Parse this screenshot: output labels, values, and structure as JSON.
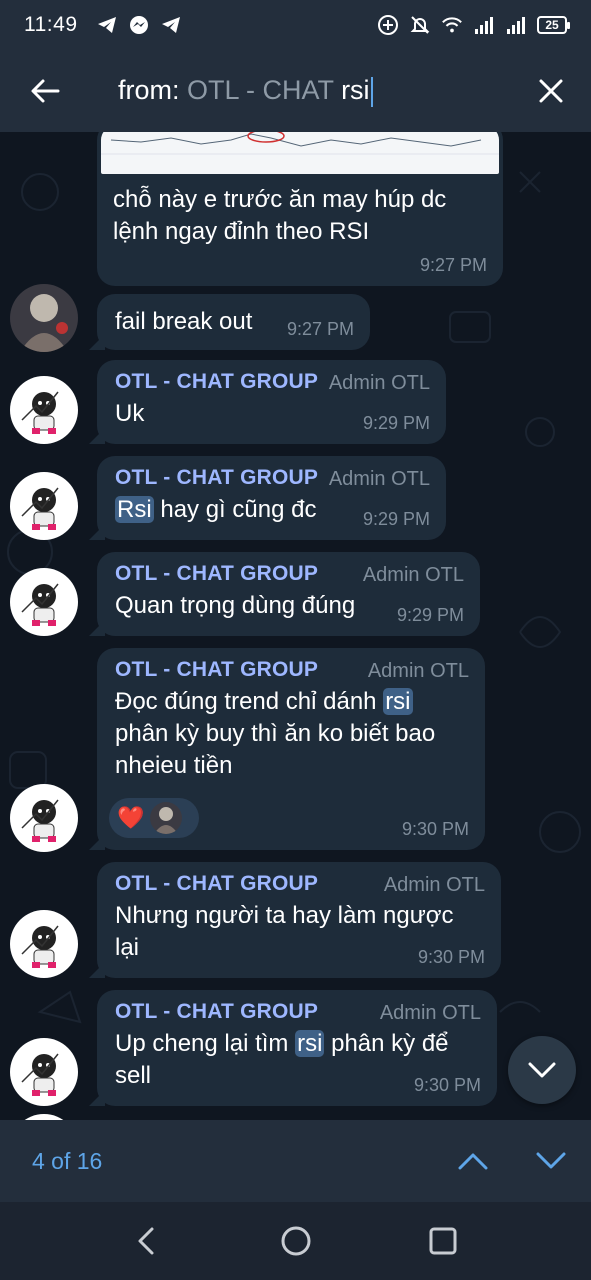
{
  "status_bar": {
    "time": "11:49",
    "battery": "25",
    "icons_left": [
      "telegram-icon",
      "messenger-icon",
      "telegram-icon"
    ],
    "icons_right": [
      "data-saver-icon",
      "mute-icon",
      "wifi-icon",
      "signal-icon",
      "signal-icon",
      "battery-icon"
    ]
  },
  "search": {
    "prefix": "from:",
    "chat_name": "OTL - CHAT",
    "query": "rsi"
  },
  "messages": [
    {
      "text": "chỗ này e trước ăn may húp dc lệnh ngay đỉnh theo RSI",
      "time": "9:27 PM",
      "has_image": true
    },
    {
      "text": "fail break out",
      "time": "9:27 PM"
    },
    {
      "sender": "OTL - CHAT GROUP",
      "role": "Admin OTL",
      "text": "Uk",
      "time": "9:29 PM"
    },
    {
      "sender": "OTL - CHAT GROUP",
      "role": "Admin OTL",
      "highlight": "Rsi",
      "text_after": " hay gì cũng đc",
      "time": "9:29 PM"
    },
    {
      "sender": "OTL - CHAT GROUP",
      "role": "Admin OTL",
      "text": "Quan trọng dùng đúng",
      "time": "9:29 PM"
    },
    {
      "sender": "OTL - CHAT GROUP",
      "role": "Admin OTL",
      "text_before": "Đọc đúng trend chỉ dánh ",
      "highlight": "rsi",
      "line2": "phân kỳ buy thì ăn ko biết bao",
      "line3": "nheieu tiền",
      "reaction": "❤️",
      "time": "9:30 PM"
    },
    {
      "sender": "OTL - CHAT GROUP",
      "role": "Admin OTL",
      "line1": "Nhưng người ta hay làm ngược",
      "line2": "lại",
      "time": "9:30 PM"
    },
    {
      "sender": "OTL - CHAT GROUP",
      "role": "Admin OTL",
      "text_before": "Up cheng lại tìm ",
      "highlight": "rsi",
      "text_after": " phân kỳ để",
      "line2": "sell",
      "time": "9:30 PM"
    }
  ],
  "results": {
    "counter": "4 of 16"
  },
  "colors": {
    "header_bg": "#232e3c",
    "bubble_bg": "#1e2c3a",
    "accent": "#5ea5e8",
    "sender": "#9eb7ff",
    "highlight": "#3f6187"
  }
}
